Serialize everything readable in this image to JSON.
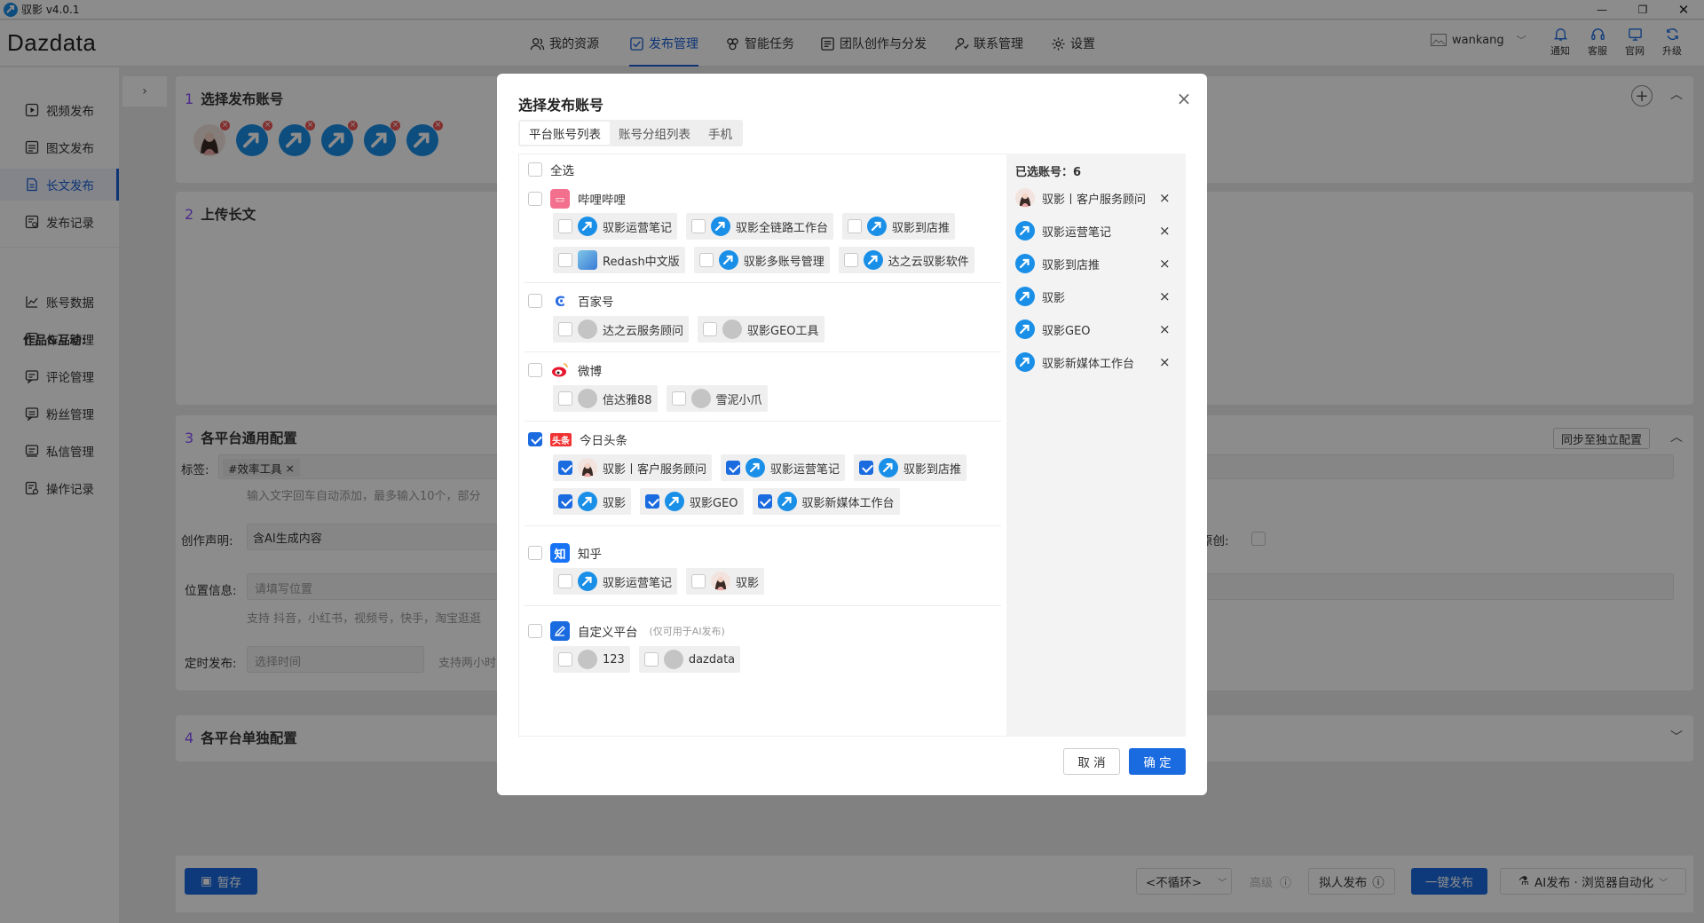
{
  "window": {
    "title": "驭影 v4.0.1"
  },
  "header": {
    "logo": "Dazdata",
    "nav": [
      {
        "label": "我的资源",
        "icon": "users-icon"
      },
      {
        "label": "发布管理",
        "icon": "publish-icon",
        "active": true
      },
      {
        "label": "智能任务",
        "icon": "robot-icon"
      },
      {
        "label": "团队创作与分发",
        "icon": "team-icon"
      },
      {
        "label": "联系管理",
        "icon": "contact-icon"
      },
      {
        "label": "设置",
        "icon": "gear-icon"
      }
    ],
    "user": "wankang",
    "tools": [
      {
        "label": "通知",
        "icon": "bell-icon"
      },
      {
        "label": "客服",
        "icon": "headset-icon"
      },
      {
        "label": "官网",
        "icon": "monitor-icon"
      },
      {
        "label": "升级",
        "icon": "refresh-icon"
      }
    ]
  },
  "sidebar": {
    "items": [
      {
        "label": "视频发布",
        "icon": "video-icon"
      },
      {
        "label": "图文发布",
        "icon": "image-text-icon"
      },
      {
        "label": "长文发布",
        "icon": "document-icon",
        "active": true
      },
      {
        "label": "发布记录",
        "icon": "history-icon"
      }
    ],
    "group_title": "作品&互动:",
    "group_items": [
      {
        "label": "账号数据",
        "icon": "chart-icon"
      },
      {
        "label": "作品管理",
        "icon": "works-icon"
      },
      {
        "label": "评论管理",
        "icon": "comment-icon"
      },
      {
        "label": "粉丝管理",
        "icon": "fans-icon"
      },
      {
        "label": "私信管理",
        "icon": "message-icon"
      },
      {
        "label": "操作记录",
        "icon": "log-icon"
      }
    ]
  },
  "main": {
    "sec1": {
      "num": "1",
      "title": "选择发布账号"
    },
    "sec2": {
      "num": "2",
      "title": "上传长文"
    },
    "sec3": {
      "num": "3",
      "title": "各平台通用配置",
      "sync_btn": "同步至独立配置",
      "tag_label": "标签:",
      "tag_value": "#效率工具",
      "tag_hint": "输入文字回车自动添加，最多输入10个，部分",
      "decl_label": "创作声明:",
      "decl_value": "含AI生成内容",
      "orig_label": "声明原创:",
      "loc_label": "位置信息:",
      "loc_placeholder": "请填写位置",
      "loc_hint": "支持 抖音，小红书，视频号，快手，淘宝逛逛",
      "timer_label": "定时发布:",
      "timer_placeholder": "选择时间",
      "timer_hint": "支持两小时"
    },
    "sec4": {
      "num": "4",
      "title": "各平台单独配置"
    }
  },
  "footer": {
    "save": "暂存",
    "loop": "<不循环>",
    "advanced": "高级",
    "human_publish": "拟人发布",
    "one_click": "一键发布",
    "ai_publish": "AI发布 · 浏览器自动化"
  },
  "modal": {
    "title": "选择发布账号",
    "tabs": [
      "平台账号列表",
      "账号分组列表",
      "手机"
    ],
    "select_all": "全选",
    "platforms": [
      {
        "name": "哔哩哔哩",
        "icon": "bilibili-icon",
        "color": "#f36f8e",
        "checked": false,
        "accounts": [
          [
            {
              "name": "驭影运营笔记",
              "avatar": "logo"
            },
            {
              "name": "驭影全链路工作台",
              "avatar": "logo"
            },
            {
              "name": "驭影到店推",
              "avatar": "logo"
            }
          ],
          [
            {
              "name": "Redash中文版",
              "avatar": "redash"
            },
            {
              "name": "驭影多账号管理",
              "avatar": "logo"
            },
            {
              "name": "达之云驭影软件",
              "avatar": "logo"
            }
          ]
        ]
      },
      {
        "name": "百家号",
        "icon": "baijiahao-icon",
        "color": "#2b6de3",
        "checked": false,
        "accounts": [
          [
            {
              "name": "达之云服务顾问",
              "avatar": "gray"
            },
            {
              "name": "驭影GEO工具",
              "avatar": "gray"
            }
          ]
        ]
      },
      {
        "name": "微博",
        "icon": "weibo-icon",
        "color": "#e6162d",
        "checked": false,
        "accounts": [
          [
            {
              "name": "信达雅88",
              "avatar": "gray"
            },
            {
              "name": "雪泥小爪",
              "avatar": "gray"
            }
          ]
        ]
      },
      {
        "name": "今日头条",
        "icon": "toutiao-icon",
        "color": "#f03232",
        "badge": "头条",
        "checked": true,
        "accounts": [
          [
            {
              "name": "驭影丨客户服务顾问",
              "avatar": "girl",
              "checked": true
            },
            {
              "name": "驭影运营笔记",
              "avatar": "logo",
              "checked": true
            },
            {
              "name": "驭影到店推",
              "avatar": "logo",
              "checked": true
            }
          ],
          [
            {
              "name": "驭影",
              "avatar": "logo",
              "checked": true
            },
            {
              "name": "驭影GEO",
              "avatar": "logo",
              "checked": true
            },
            {
              "name": "驭影新媒体工作台",
              "avatar": "logo",
              "checked": true
            }
          ]
        ]
      },
      {
        "name": "知乎",
        "icon": "zhihu-icon",
        "color": "#1772f6",
        "badge": "知",
        "checked": false,
        "accounts": [
          [
            {
              "name": "驭影运营笔记",
              "avatar": "logo"
            },
            {
              "name": "驭影",
              "avatar": "girl"
            }
          ]
        ]
      },
      {
        "name": "自定义平台",
        "note": "(仅可用于AI发布)",
        "icon": "custom-platform-icon",
        "color": "#1a6ae0",
        "checked": false,
        "accounts": [
          [
            {
              "name": "123",
              "avatar": "gray"
            },
            {
              "name": "dazdata",
              "avatar": "gray"
            }
          ]
        ]
      }
    ],
    "selected_title": "已选账号：6",
    "selected": [
      {
        "name": "驭影丨客户服务顾问",
        "avatar": "girl"
      },
      {
        "name": "驭影运营笔记",
        "avatar": "logo"
      },
      {
        "name": "驭影到店推",
        "avatar": "logo"
      },
      {
        "name": "驭影",
        "avatar": "logo"
      },
      {
        "name": "驭影GEO",
        "avatar": "logo"
      },
      {
        "name": "驭影新媒体工作台",
        "avatar": "logo"
      }
    ],
    "cancel": "取 消",
    "confirm": "确 定"
  },
  "colors": {
    "accent": "#1a5fd6",
    "primary_btn": "#1a6ae0",
    "section_num": "#8a4fff"
  }
}
